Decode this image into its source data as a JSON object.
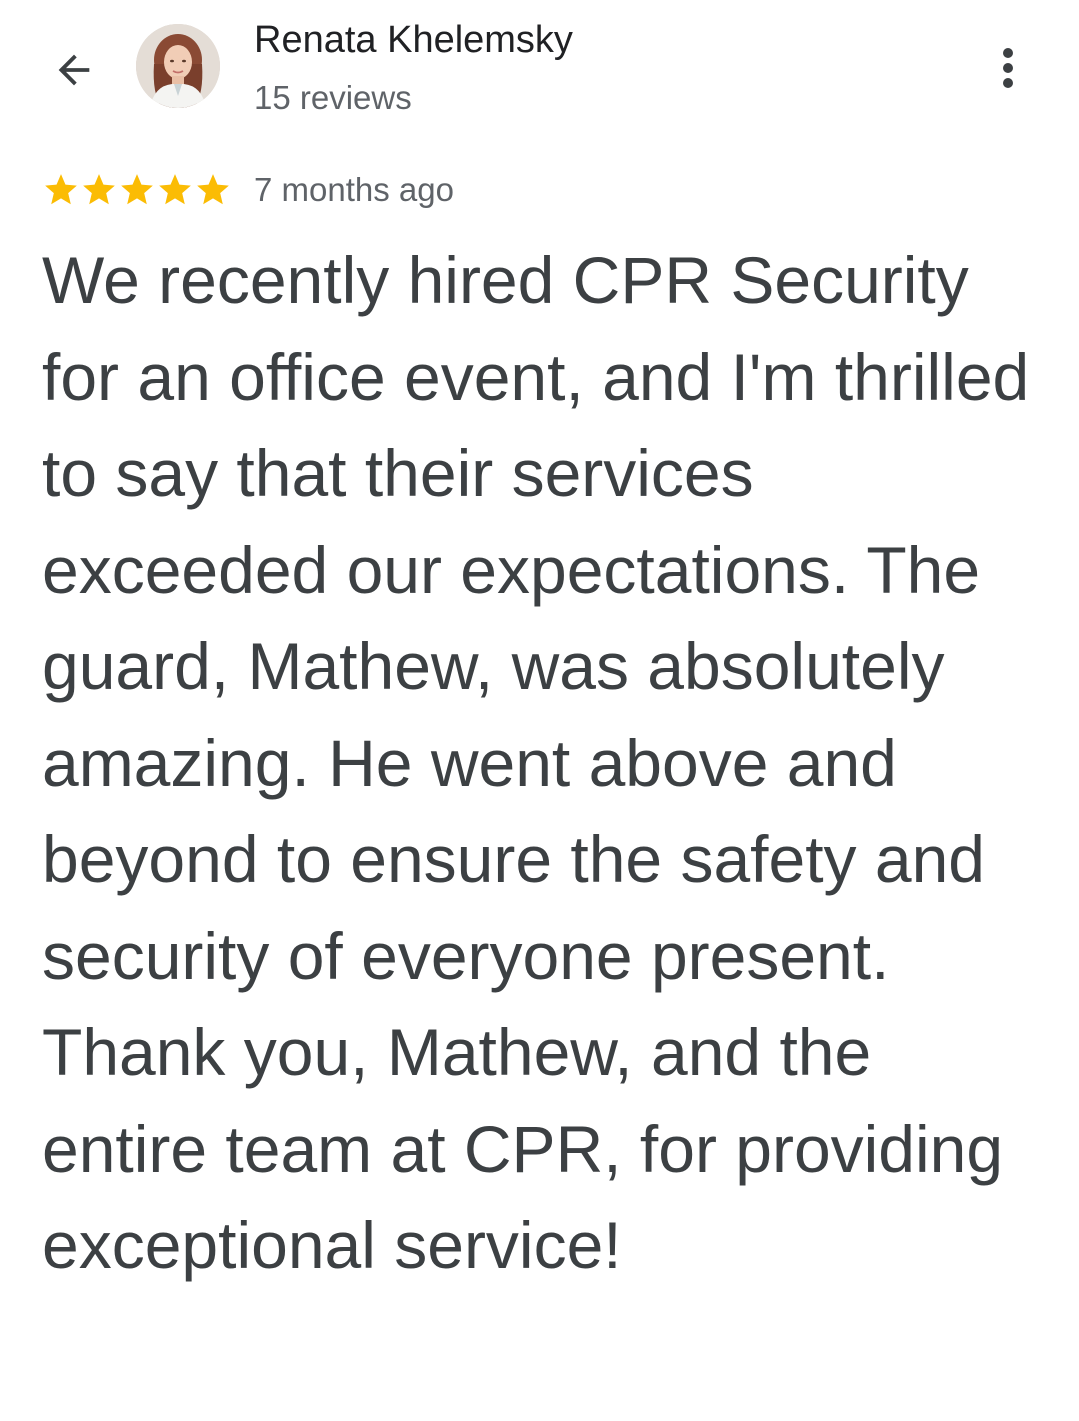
{
  "header": {
    "back_icon": "arrow-left-icon",
    "avatar_icon": "reviewer-avatar",
    "reviewer_name": "Renata Khelemsky",
    "review_count": "15 reviews",
    "more_icon": "more-vert-icon"
  },
  "review": {
    "rating": 5,
    "rating_max": 5,
    "star_color": "#fbbc04",
    "date": "7 months ago",
    "text": "We recently hired CPR Security for an office event, and I'm thrilled to say that their services exceeded our expectations. The guard, Mathew, was absolutely amazing. He went above and beyond to ensure the safety and security of everyone present. Thank you, Mathew, and the entire team at CPR, for providing exceptional service!"
  }
}
